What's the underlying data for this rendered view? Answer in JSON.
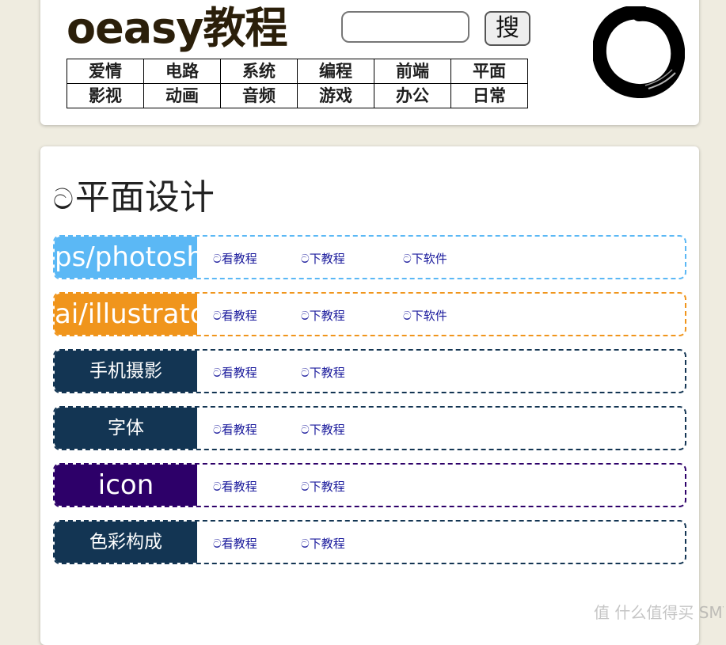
{
  "header": {
    "logo": "oeasy教程",
    "search": {
      "value": "",
      "placeholder": "",
      "button_label": "搜"
    },
    "nav": [
      [
        "爱情",
        "电路",
        "系统",
        "编程",
        "前端",
        "平面"
      ],
      [
        "影视",
        "动画",
        "音频",
        "游戏",
        "办公",
        "日常"
      ]
    ]
  },
  "section": {
    "title_icon": "ට",
    "title": "平面设计"
  },
  "rows": [
    {
      "label": "ps/photoshop",
      "color": "#5bb8f5",
      "links": [
        "ට看教程",
        "ට下教程",
        "ට下软件"
      ]
    },
    {
      "label": "ai/illustrator",
      "color": "#f0951c",
      "links": [
        "ට看教程",
        "ට下教程",
        "ට下软件"
      ]
    },
    {
      "label": "手机摄影",
      "color": "#133553",
      "links": [
        "ට看教程",
        "ට下教程"
      ]
    },
    {
      "label": "字体",
      "color": "#133553",
      "links": [
        "ට看教程",
        "ට下教程"
      ]
    },
    {
      "label": "icon",
      "color": "#2d0069",
      "links": [
        "ට看教程",
        "ට下教程"
      ]
    },
    {
      "label": "色彩构成",
      "color": "#133553",
      "links": [
        "ට看教程",
        "ට下教程"
      ]
    }
  ],
  "colors": {
    "background": "#efece0",
    "link": "#1a1a9c",
    "logo": "#2b1f0a"
  },
  "watermark": "值 什么值得买 SMYZ.NET"
}
